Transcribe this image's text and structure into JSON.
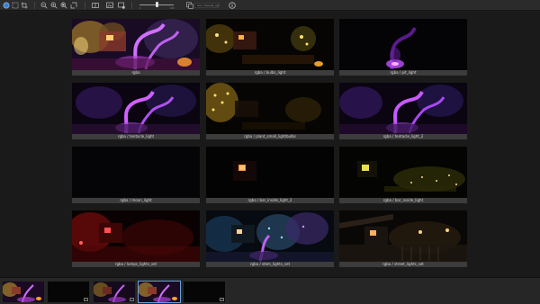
{
  "toolbar": {
    "icons": [
      "globe-icon",
      "select-icon",
      "crop-icon",
      "zoom-out-icon",
      "zoom-in-icon",
      "zoom-fit-icon",
      "rotate-icon",
      "compare-icon",
      "gallery-icon",
      "add-icon",
      "info-icon"
    ],
    "slider_min": "1",
    "slider_max": "100",
    "slider_value": 0.5,
    "path_text": "aov / beauty_lgts"
  },
  "grid": {
    "captions": [
      "rgba",
      "rgba / bulbs_light",
      "rgba / pit_light",
      "rgba / tentacle_light",
      "rgba / plant_small_lightbulbs",
      "rgba / tentacle_light_2",
      "rgba / moon_light",
      "rgba / bar_inside_light_2",
      "rgba / bar_inside_light",
      "rgba / lamps_lights_set",
      "rgba / stem_lights_set",
      "rgba / street_lights_set"
    ]
  },
  "filmstrip": {
    "selected_index": 3
  },
  "colors": {
    "accent": "#6aa0d8",
    "caption_bg": "#3c3c3c"
  }
}
